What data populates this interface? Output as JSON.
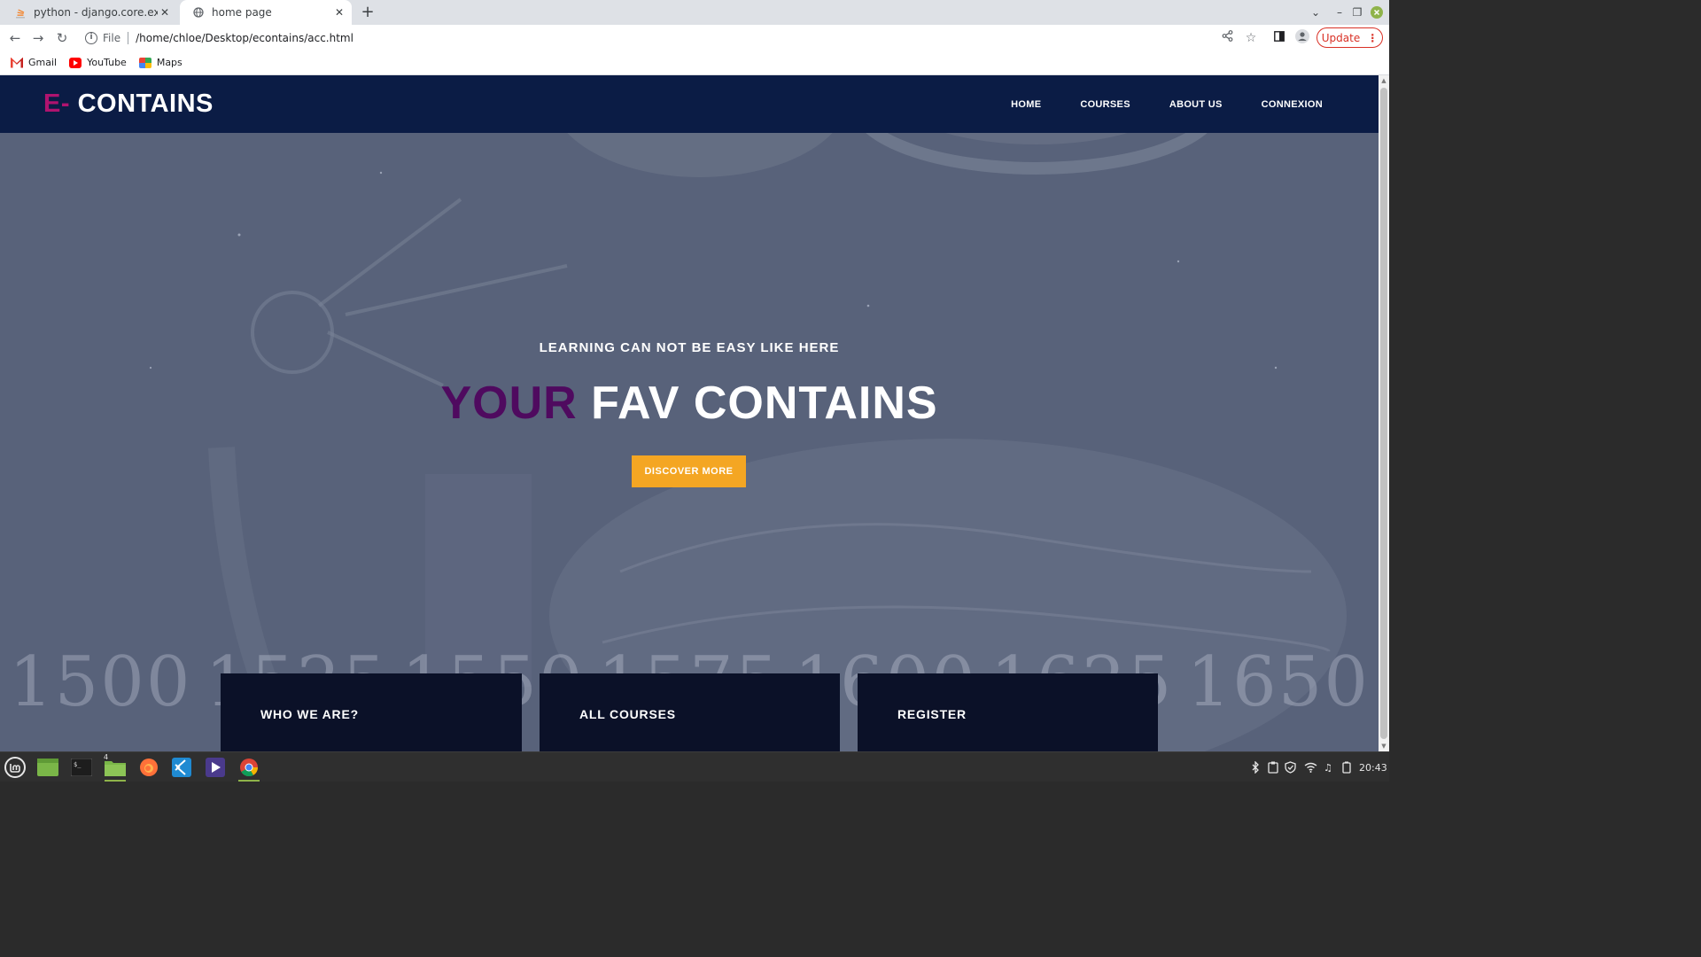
{
  "browser": {
    "tabs": [
      {
        "title": "python - django.core.exceptio",
        "icon": "stackoverflow-icon",
        "active": false
      },
      {
        "title": "home page",
        "icon": "globe-icon",
        "active": true
      }
    ],
    "address": {
      "scheme": "File",
      "url": "/home/chloe/Desktop/econtains/acc.html"
    },
    "update_label": "Update",
    "bookmarks": [
      {
        "label": "Gmail",
        "icon": "gmail-icon"
      },
      {
        "label": "YouTube",
        "icon": "youtube-icon"
      },
      {
        "label": "Maps",
        "icon": "maps-icon"
      }
    ]
  },
  "site": {
    "logo_accent": "E-",
    "logo_text": "CONTAINS",
    "nav": [
      "HOME",
      "COURSES",
      "ABOUT US",
      "CONNEXION"
    ],
    "hero": {
      "subtitle": "LEARNING CAN NOT BE EASY LIKE HERE",
      "title_accent": "YOUR",
      "title_rest": "FAV CONTAINS",
      "cta": "DISCOVER MORE"
    },
    "background_years": [
      "1500",
      "1525",
      "1550",
      "1575",
      "1600",
      "1625",
      "1650"
    ],
    "cards": [
      "WHO WE ARE?",
      "ALL COURSES",
      "REGISTER"
    ]
  },
  "taskbar": {
    "clock": "20:43",
    "files_badge": "4"
  },
  "colors": {
    "nav_bg": "#0b1c45",
    "logo_accent": "#b0136f",
    "title_accent": "#4f0a5f",
    "cta_bg": "#f4a623",
    "card_bg": "#0b1128",
    "update_red": "#d93025"
  }
}
